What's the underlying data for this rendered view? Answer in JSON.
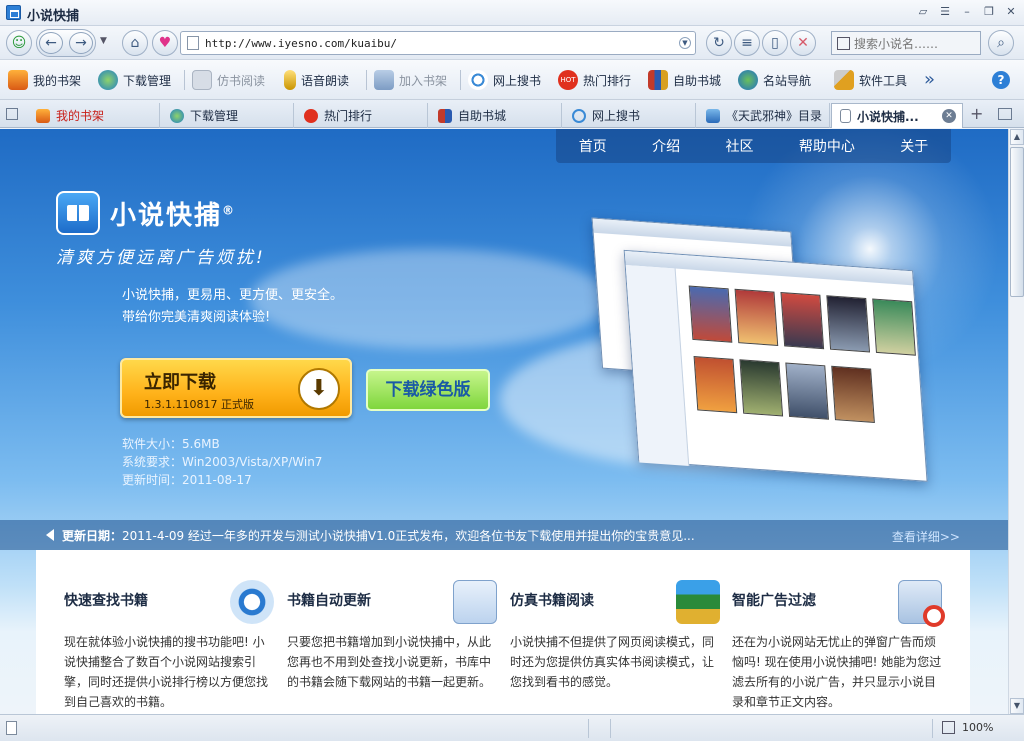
{
  "window": {
    "title": "小说快捕"
  },
  "address": {
    "url": "http://www.iyesno.com/kuaibu/",
    "search_placeholder": "搜索小说名……"
  },
  "toolbar": {
    "items": [
      {
        "label": "我的书架"
      },
      {
        "label": "下载管理"
      },
      {
        "label": "仿书阅读",
        "disabled": true
      },
      {
        "label": "语音朗读"
      },
      {
        "label": "加入书架",
        "disabled": true
      },
      {
        "label": "网上搜书"
      },
      {
        "label": "热门排行"
      },
      {
        "label": "自助书城"
      },
      {
        "label": "名站导航"
      },
      {
        "label": "软件工具"
      }
    ],
    "more": "»",
    "help": "?"
  },
  "tabs": [
    {
      "label": "我的书架"
    },
    {
      "label": "下载管理"
    },
    {
      "label": "热门排行"
    },
    {
      "label": "自助书城"
    },
    {
      "label": "网上搜书"
    },
    {
      "label": "《天武邪神》目录"
    },
    {
      "label": "小说快捕..."
    }
  ],
  "page": {
    "nav": [
      "首页",
      "介绍",
      "社区",
      "帮助中心",
      "关于"
    ],
    "logo": "小说快捕",
    "logo_mark": "®",
    "slogan": "清爽方便远离广告烦扰!",
    "intro_line1": "小说快捕，更易用、更方便、更安全。",
    "intro_line2": "带给你完美清爽阅读体验!",
    "download": {
      "title": "立即下载",
      "version": "1.3.1.110817 正式版"
    },
    "green_download": "下载绿色版",
    "specs": {
      "size": "软件大小：5.6MB",
      "system": "系统要求：Win2003/Vista/XP/Win7",
      "updated": "更新时间：2011-08-17"
    },
    "news": {
      "label": "更新日期：",
      "text": "2011-4-09 经过一年多的开发与测试小说快捕V1.0正式发布，欢迎各位书友下载使用并提出你的宝贵意见...",
      "more": "查看详细>>"
    },
    "features": [
      {
        "title": "快速查找书籍",
        "text": "现在就体验小说快捕的搜书功能吧! 小说快捕整合了数百个小说网站搜索引擎，同时还提供小说排行榜以方便您找到自己喜欢的书籍。"
      },
      {
        "title": "书籍自动更新",
        "text": "只要您把书籍增加到小说快捕中，从此您再也不用到处查找小说更新，书库中的书籍会随下载网站的书籍一起更新。"
      },
      {
        "title": "仿真书籍阅读",
        "text": "小说快捕不但提供了网页阅读模式，同时还为您提供仿真实体书阅读模式，让您找到看书的感觉。"
      },
      {
        "title": "智能广告过滤",
        "text": "还在为小说网站无忧止的弹窗广告而烦恼吗! 现在使用小说快捕吧! 她能为您过滤去所有的小说广告，并只显示小说目录和章节正文内容。"
      }
    ]
  },
  "status": {
    "zoom": "100%"
  }
}
